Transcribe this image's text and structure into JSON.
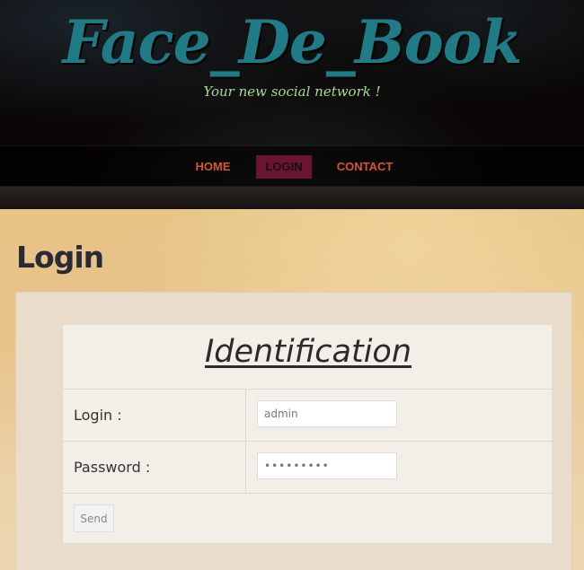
{
  "site": {
    "title": "Face_De_Book",
    "tagline": "Your new social network !"
  },
  "nav": {
    "items": [
      {
        "label": "HOME"
      },
      {
        "label": "LOGIN"
      },
      {
        "label": "CONTACT"
      }
    ]
  },
  "page": {
    "title": "Login"
  },
  "form": {
    "heading": "Identification",
    "login_label": "Login :",
    "login_value": "admin",
    "password_label": "Password :",
    "password_value": "•••••••••",
    "send_label": "Send"
  },
  "colors": {
    "title": "#1f7b86",
    "tagline": "#a8d89a",
    "nav_link": "#d6552e",
    "nav_active_bg": "#6b1333"
  }
}
